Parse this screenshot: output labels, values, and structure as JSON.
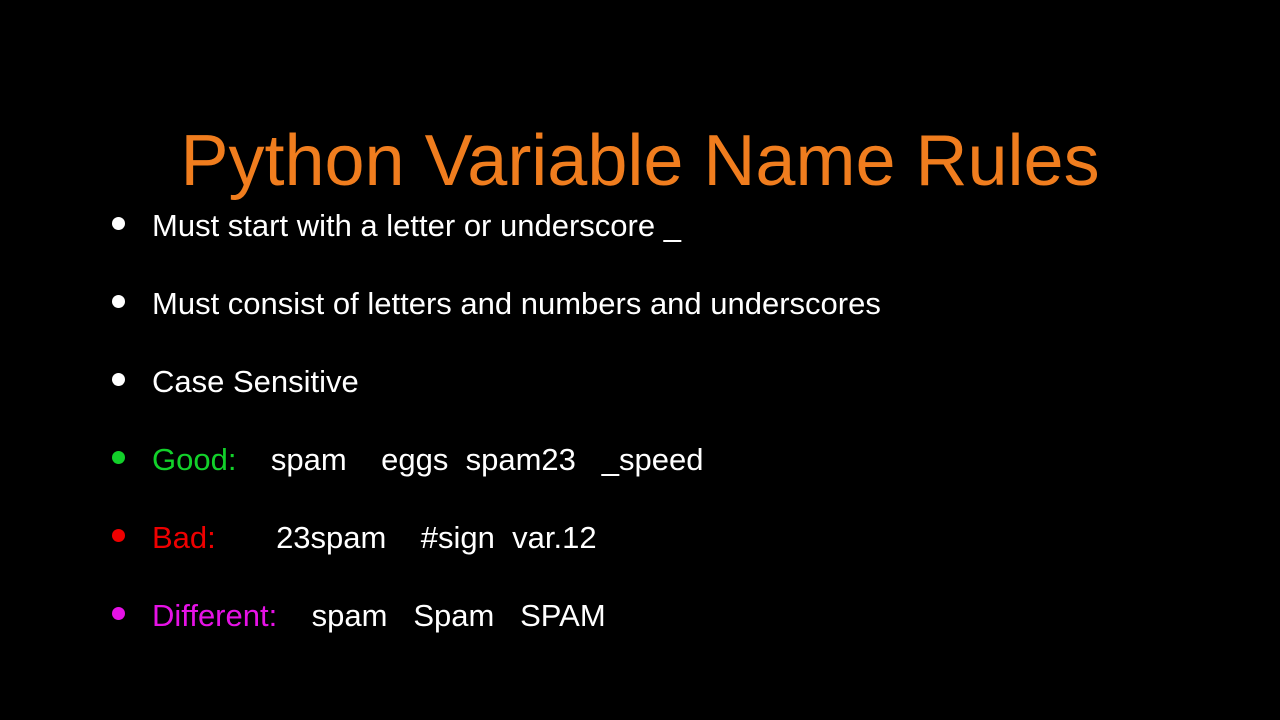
{
  "slide": {
    "background_color": "#000000",
    "title": "Python Variable Name Rules",
    "title_color": "#F07D1E",
    "default_text_color": "#FFFFFF",
    "bullets": [
      {
        "bullet_color": "#FFFFFF",
        "label": "Must start with a letter or underscore _",
        "label_color": "#FFFFFF",
        "examples": ""
      },
      {
        "bullet_color": "#FFFFFF",
        "label": "Must consist of letters and numbers and underscores",
        "label_color": "#FFFFFF",
        "examples": ""
      },
      {
        "bullet_color": "#FFFFFF",
        "label": "Case Sensitive",
        "label_color": "#FFFFFF",
        "examples": ""
      },
      {
        "bullet_color": "#12D12A",
        "label": "Good:",
        "label_color": "#12D12A",
        "examples": "    spam    eggs  spam23   _speed"
      },
      {
        "bullet_color": "#EE0000",
        "label": "Bad:",
        "label_color": "#EE0000",
        "examples": "       23spam    #sign  var.12"
      },
      {
        "bullet_color": "#E612E6",
        "label": "Different:",
        "label_color": "#E612E6",
        "examples": "    spam   Spam   SPAM"
      }
    ]
  }
}
